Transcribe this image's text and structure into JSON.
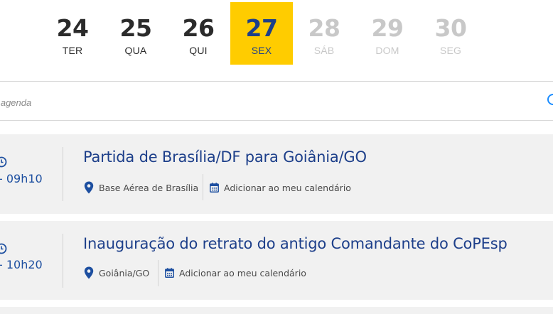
{
  "days": [
    {
      "num": "24",
      "weekday": "TER",
      "state": "past"
    },
    {
      "num": "25",
      "weekday": "QUA",
      "state": "past"
    },
    {
      "num": "26",
      "weekday": "QUI",
      "state": "past"
    },
    {
      "num": "27",
      "weekday": "SEX",
      "state": "selected"
    },
    {
      "num": "28",
      "weekday": "SÁB",
      "state": "future"
    },
    {
      "num": "29",
      "weekday": "DOM",
      "state": "future"
    },
    {
      "num": "30",
      "weekday": "SEG",
      "state": "future"
    }
  ],
  "search": {
    "placeholder": "Buscar na agenda",
    "visible_placeholder": "n agenda"
  },
  "events": [
    {
      "time": "- 09h10",
      "title": "Partida de Brasília/DF para Goiânia/GO",
      "location": "Base Aérea de Brasília",
      "calendar_label": "Adicionar ao meu calendário"
    },
    {
      "time": "- 10h20",
      "title": "Inauguração do retrato do antigo Comandante do CoPEsp",
      "location": "Goiânia/GO",
      "calendar_label": "Adicionar ao meu calendário"
    }
  ],
  "colors": {
    "selected_bg": "#ffcc00",
    "accent_blue": "#1d3f8a",
    "time_blue": "#1d4fa0",
    "past_text": "#2b2b2b",
    "future_text": "#c8c8c8",
    "card_bg": "#f1f1f1"
  },
  "icons": {
    "time": "clock-icon",
    "location": "map-pin-icon",
    "calendar": "calendar-icon"
  }
}
